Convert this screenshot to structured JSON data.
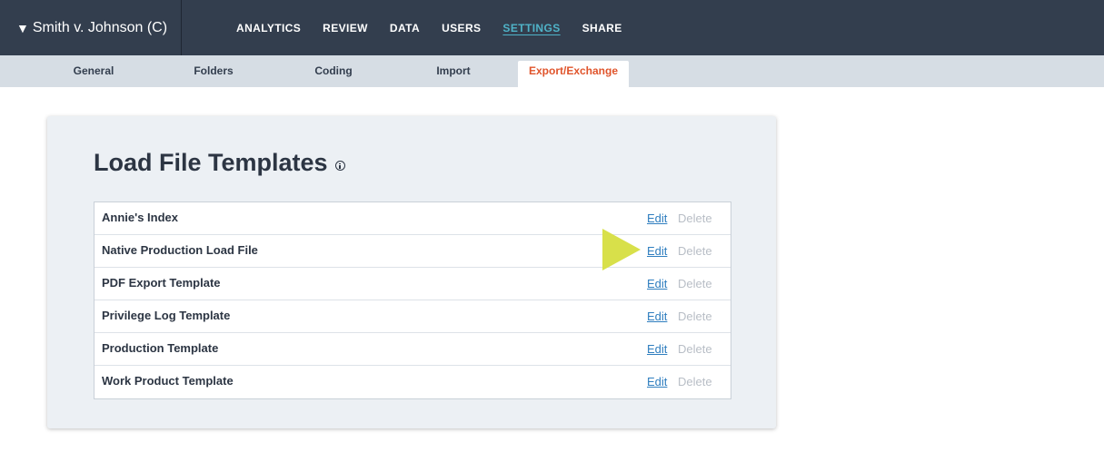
{
  "header": {
    "case_title": "Smith v. Johnson (C)",
    "case_caret": "▼",
    "nav": [
      {
        "label": "ANALYTICS"
      },
      {
        "label": "REVIEW"
      },
      {
        "label": "DATA"
      },
      {
        "label": "USERS"
      },
      {
        "label": "SETTINGS",
        "active": true
      },
      {
        "label": "SHARE"
      }
    ]
  },
  "subnav": {
    "tabs": [
      {
        "label": "General"
      },
      {
        "label": "Folders"
      },
      {
        "label": "Coding"
      },
      {
        "label": "Import"
      },
      {
        "label": "Export/Exchange",
        "active": true
      }
    ]
  },
  "main": {
    "title": "Load File Templates",
    "edit_label": "Edit",
    "delete_label": "Delete",
    "templates": [
      {
        "name": "Annie's Index"
      },
      {
        "name": "Native Production Load File"
      },
      {
        "name": "PDF Export Template"
      },
      {
        "name": "Privilege Log Template"
      },
      {
        "name": "Production Template"
      },
      {
        "name": "Work Product Template"
      }
    ]
  },
  "colors": {
    "header_bg": "#333e4e",
    "active_nav": "#4fb3c8",
    "active_subtab": "#e0542b",
    "link": "#2f7ebf",
    "arrow": "#d8e04a"
  }
}
